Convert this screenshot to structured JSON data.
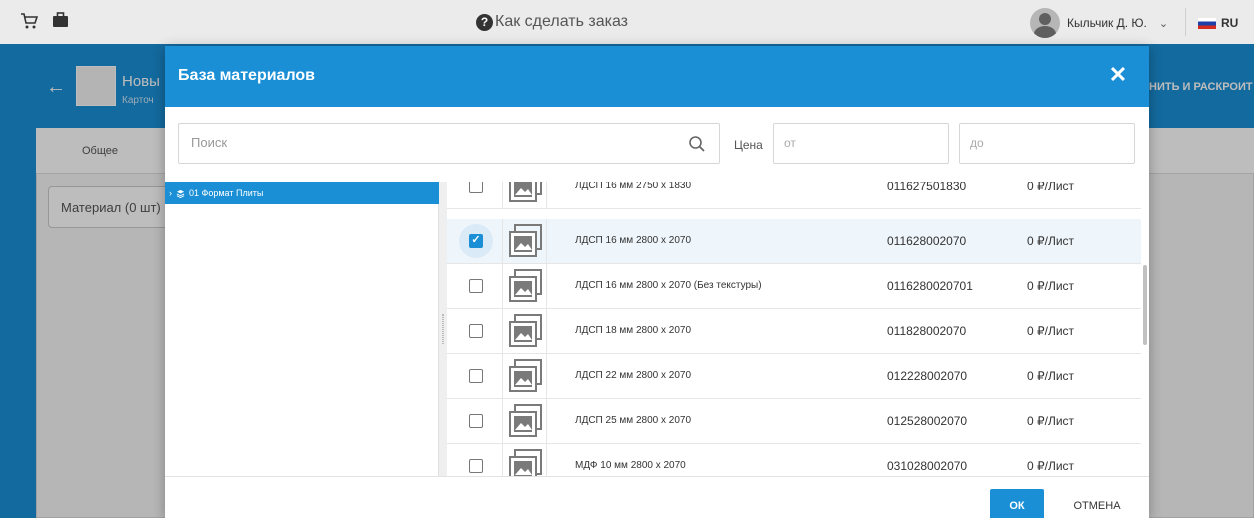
{
  "topbar": {
    "help_label": "Как сделать заказ",
    "user_name": "Кыльчик Д. Ю.",
    "lang": "RU"
  },
  "background": {
    "title": "Новы",
    "subtitle": "Карточ",
    "tab_general": "Общее",
    "material_field": "Материал (0 шт)",
    "save_button": "НИТЬ И РАСКРОИТ"
  },
  "modal": {
    "title": "База материалов",
    "search_placeholder": "Поиск",
    "price_label": "Цена",
    "price_from_placeholder": "от",
    "price_to_placeholder": "до",
    "tree": [
      {
        "label": "01 Формат Плиты"
      }
    ],
    "rows": [
      {
        "name": "ЛДСП 16 мм 2750 x 1830",
        "code": "011627501830",
        "price": "0 ₽/Лист",
        "checked": false
      },
      {
        "name": "ЛДСП 16 мм 2800 x 2070",
        "code": "011628002070",
        "price": "0 ₽/Лист",
        "checked": true
      },
      {
        "name": "ЛДСП 16 мм 2800 x 2070 (Без текстуры)",
        "code": "0116280020701",
        "price": "0 ₽/Лист",
        "checked": false
      },
      {
        "name": "ЛДСП 18 мм 2800 x 2070",
        "code": "011828002070",
        "price": "0 ₽/Лист",
        "checked": false
      },
      {
        "name": "ЛДСП 22 мм 2800 x 2070",
        "code": "012228002070",
        "price": "0 ₽/Лист",
        "checked": false
      },
      {
        "name": "ЛДСП 25 мм 2800 x 2070",
        "code": "012528002070",
        "price": "0 ₽/Лист",
        "checked": false
      },
      {
        "name": "МДФ 10 мм 2800 x 2070",
        "code": "031028002070",
        "price": "0 ₽/Лист",
        "checked": false
      }
    ],
    "ok_label": "ОК",
    "cancel_label": "ОТМЕНА"
  },
  "colors": {
    "accent": "#1a8fd6",
    "selected_row": "#eef5fb"
  }
}
